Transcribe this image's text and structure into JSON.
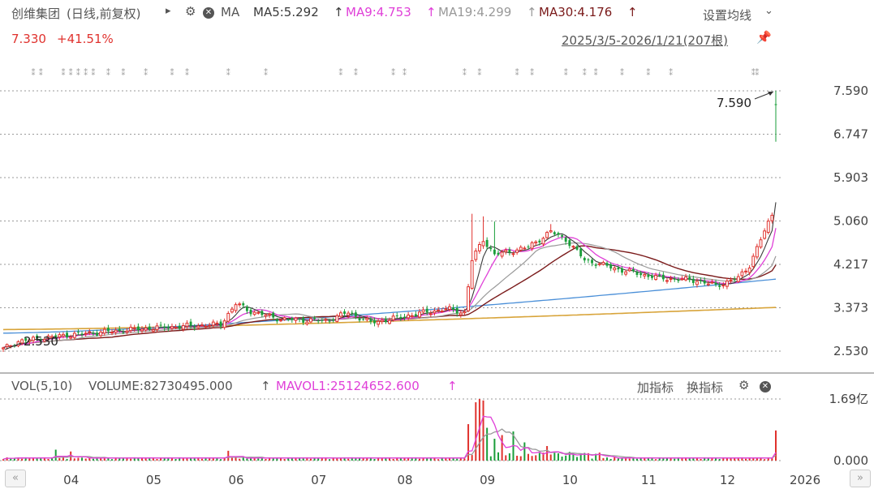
{
  "header": {
    "stock_name": "创维集团",
    "period_note": "(日线,前复权)",
    "expand_arrow": "▸",
    "ma_label": "MA",
    "ma5": "MA5:5.292",
    "ma9": "MA9:4.753",
    "ma19": "MA19:4.299",
    "ma30": "MA30:4.176",
    "up_arrow": "↑",
    "settings": "设置均线",
    "settings_arrow": "⌄",
    "price": "7.330",
    "change": "+41.51%",
    "range": "2025/3/5-2026/1/21(207根)"
  },
  "volume_header": {
    "vol_label": "VOL(5,10)",
    "volume": "VOLUME:82730495.000",
    "volume_arrow": "↑",
    "mavol1": "MAVOL1:25124652.600",
    "mavol1_arrow": "↑",
    "add_indicator": "加指标",
    "switch_indicator": "换指标"
  },
  "colors": {
    "up": "#e0322e",
    "down": "#1a9e3a",
    "ma5": "#3a3a3a",
    "ma9": "#e040d8",
    "ma19": "#999999",
    "ma30": "#7a1a1a",
    "ma60": "#4a8fd8",
    "ma120": "#d8a43a",
    "mavol1": "#e040d8",
    "mavol2": "#999999"
  },
  "chart_data": {
    "type": "candlestick",
    "x_ticks": [
      "04",
      "05",
      "06",
      "07",
      "08",
      "09",
      "10",
      "11",
      "12",
      "2026"
    ],
    "y_ticks": [
      "7.590",
      "6.747",
      "5.903",
      "5.060",
      "4.217",
      "3.373",
      "2.530"
    ],
    "y_range": [
      2.53,
      7.59
    ],
    "annotations": [
      {
        "label": "7.590",
        "value": 7.59,
        "kind": "high"
      },
      {
        "label": "2.530",
        "value": 2.53,
        "kind": "low"
      }
    ],
    "keyframes": [
      {
        "i": 0,
        "c": 2.57
      },
      {
        "i": 4,
        "c": 2.72
      },
      {
        "i": 18,
        "c": 2.85
      },
      {
        "i": 40,
        "c": 2.98
      },
      {
        "i": 58,
        "c": 3.05
      },
      {
        "i": 62,
        "c": 3.45
      },
      {
        "i": 66,
        "c": 3.3
      },
      {
        "i": 74,
        "c": 3.15
      },
      {
        "i": 86,
        "c": 3.12
      },
      {
        "i": 92,
        "c": 3.28
      },
      {
        "i": 98,
        "c": 3.08
      },
      {
        "i": 110,
        "c": 3.25
      },
      {
        "i": 118,
        "c": 3.35
      },
      {
        "i": 123,
        "c": 3.28
      },
      {
        "i": 125,
        "c": 4.3
      },
      {
        "i": 128,
        "c": 4.7
      },
      {
        "i": 131,
        "c": 4.4
      },
      {
        "i": 140,
        "c": 4.55
      },
      {
        "i": 146,
        "c": 4.85
      },
      {
        "i": 150,
        "c": 4.7
      },
      {
        "i": 155,
        "c": 4.3
      },
      {
        "i": 165,
        "c": 4.1
      },
      {
        "i": 175,
        "c": 3.95
      },
      {
        "i": 185,
        "c": 3.9
      },
      {
        "i": 190,
        "c": 3.8
      },
      {
        "i": 196,
        "c": 3.95
      },
      {
        "i": 199,
        "c": 4.2
      },
      {
        "i": 202,
        "c": 4.7
      },
      {
        "i": 205,
        "c": 5.18
      },
      {
        "i": 206,
        "c": 7.33
      }
    ],
    "spikes": [
      {
        "i": 125,
        "h": 5.2
      },
      {
        "i": 128,
        "h": 5.15
      },
      {
        "i": 131,
        "h": 5.05
      },
      {
        "i": 146,
        "h": 5.0
      },
      {
        "i": 206,
        "h": 7.59,
        "l": 6.6
      }
    ],
    "ma60_range": [
      2.88,
      3.93
    ],
    "ma120_range": [
      2.95,
      3.38
    ],
    "volume": {
      "y_ticks": [
        "1.69亿",
        "0.000"
      ],
      "max": 169000000,
      "last": 82730495,
      "peaks": [
        {
          "i": 14,
          "v": 30000000
        },
        {
          "i": 18,
          "v": 25000000
        },
        {
          "i": 60,
          "v": 27000000
        },
        {
          "i": 124,
          "v": 100000000
        },
        {
          "i": 126,
          "v": 160000000
        },
        {
          "i": 127,
          "v": 169000000
        },
        {
          "i": 128,
          "v": 165000000
        },
        {
          "i": 129,
          "v": 90000000
        },
        {
          "i": 131,
          "v": 60000000
        },
        {
          "i": 133,
          "v": 70000000
        },
        {
          "i": 136,
          "v": 80000000
        },
        {
          "i": 139,
          "v": 50000000
        },
        {
          "i": 145,
          "v": 40000000
        },
        {
          "i": 206,
          "v": 82730495
        }
      ]
    }
  }
}
